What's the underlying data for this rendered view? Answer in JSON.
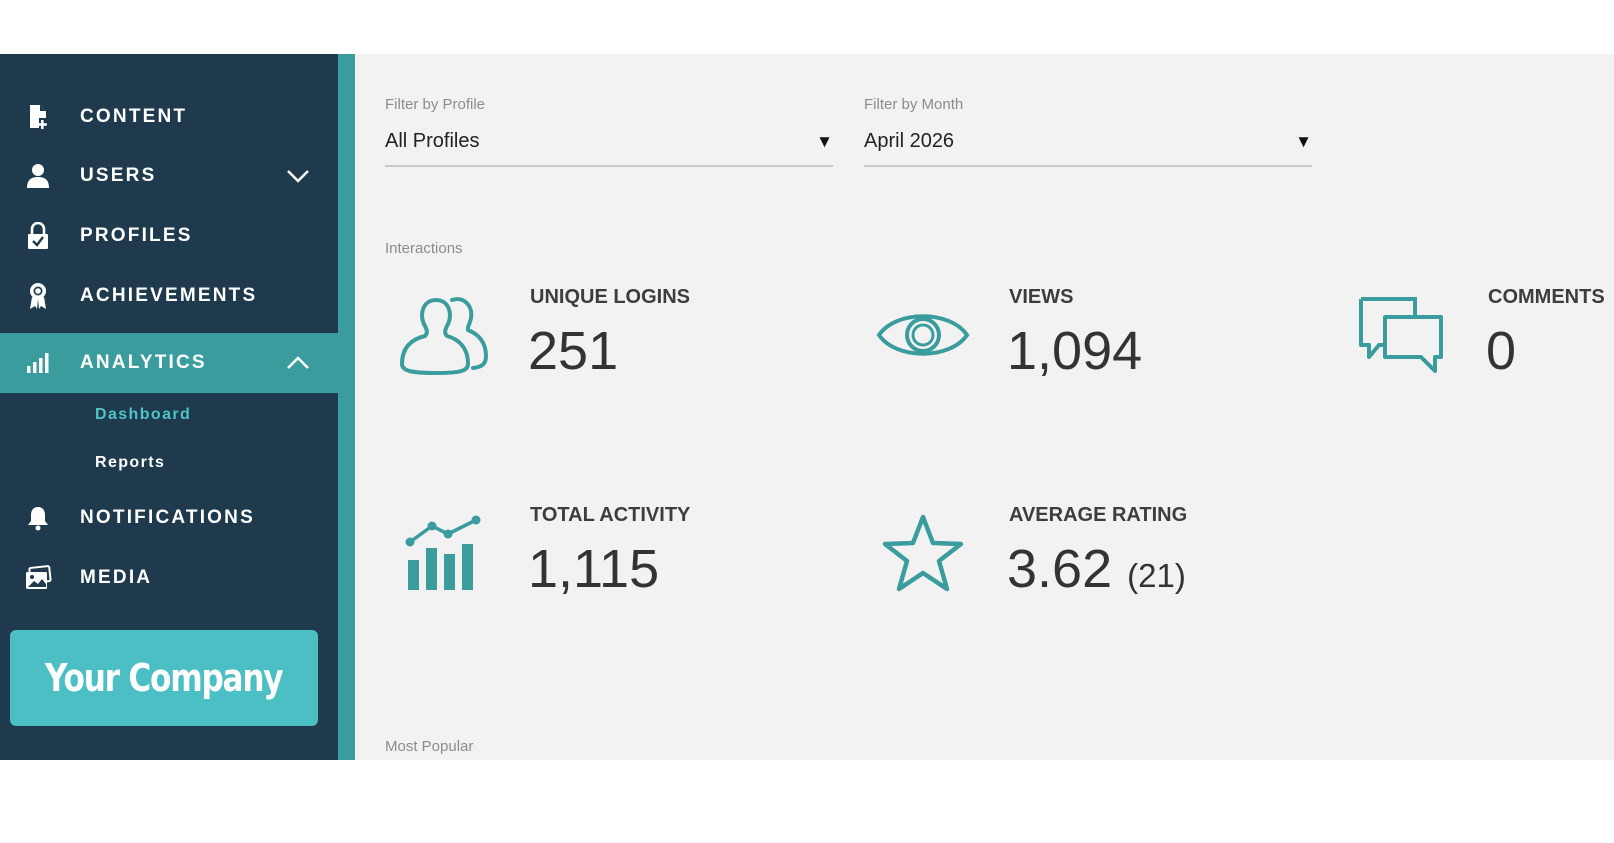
{
  "colors": {
    "sidebar": "#1e3a4c",
    "accent": "#3a9c9d",
    "teal_light": "#4bbfc4",
    "background": "#f2f2f2"
  },
  "sidebar": {
    "items": [
      {
        "label": "CONTENT",
        "icon": "document-add-icon"
      },
      {
        "label": "USERS",
        "icon": "user-icon",
        "chevron": "chevron-down-icon"
      },
      {
        "label": "PROFILES",
        "icon": "lock-check-icon"
      },
      {
        "label": "ACHIEVEMENTS",
        "icon": "award-ribbon-icon"
      },
      {
        "label": "ANALYTICS",
        "icon": "bar-chart-icon",
        "chevron": "chevron-up-icon",
        "active": true
      },
      {
        "label": "NOTIFICATIONS",
        "icon": "bell-icon"
      },
      {
        "label": "MEDIA",
        "icon": "image-gallery-icon"
      }
    ],
    "subitems": [
      {
        "label": "Dashboard",
        "current": true
      },
      {
        "label": "Reports",
        "current": false
      }
    ],
    "company_logo_text": "Your Company"
  },
  "filters": {
    "profile": {
      "label": "Filter by Profile",
      "value": "All Profiles"
    },
    "month": {
      "label": "Filter by Month",
      "value": "April 2026"
    }
  },
  "sections": {
    "interactions": "Interactions",
    "most_popular": "Most Popular"
  },
  "stats": {
    "unique_logins": {
      "title": "UNIQUE LOGINS",
      "value": "251",
      "icon": "users-outline-icon"
    },
    "views": {
      "title": "VIEWS",
      "value": "1,094",
      "icon": "eye-icon"
    },
    "comments": {
      "title": "COMMENTS",
      "value": "0",
      "icon": "chat-bubbles-icon"
    },
    "total_activity": {
      "title": "TOTAL ACTIVITY",
      "value": "1,115",
      "icon": "activity-chart-icon"
    },
    "average_rating": {
      "title": "AVERAGE RATING",
      "value": "3.62",
      "count": "(21)",
      "icon": "star-outline-icon"
    }
  }
}
